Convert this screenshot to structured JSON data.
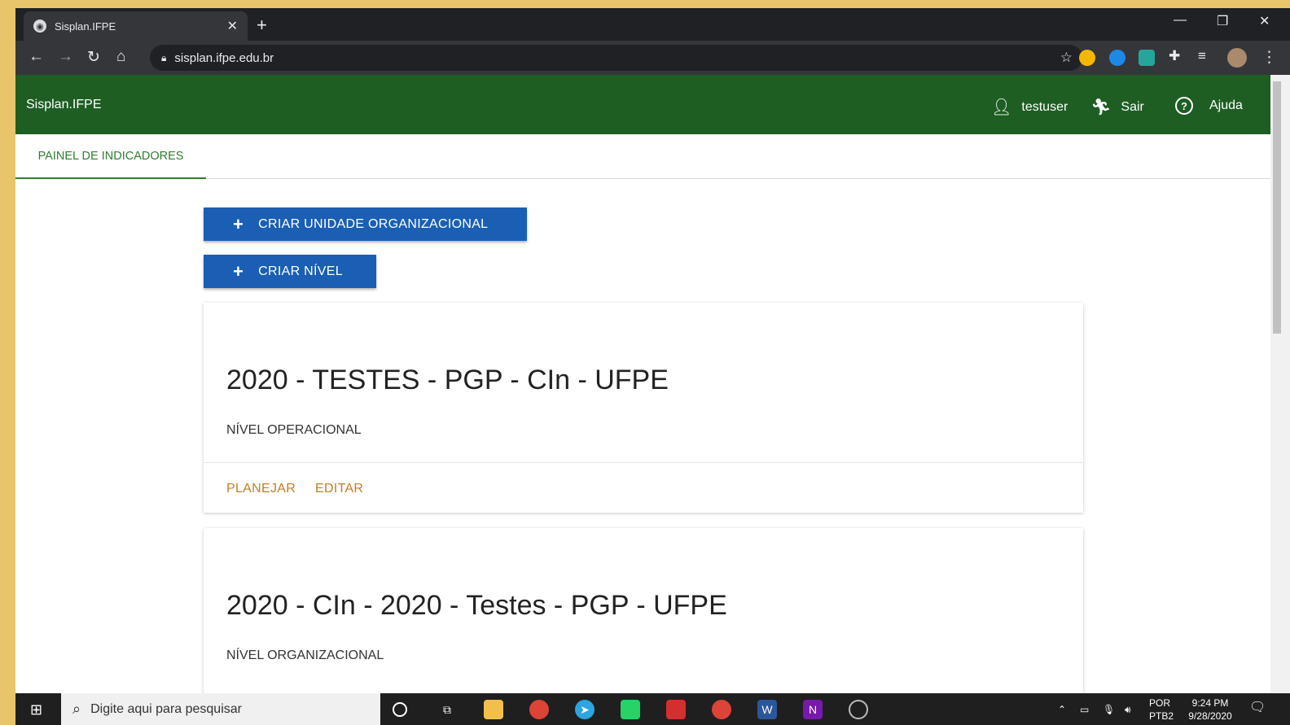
{
  "browser": {
    "tab_title": "Sisplan.IFPE",
    "url": "sisplan.ifpe.edu.br"
  },
  "app": {
    "brand": "Sisplan.IFPE",
    "user": "testuser",
    "logout": "Sair",
    "help": "Ajuda",
    "nav_tab": "PAINEL DE INDICADORES"
  },
  "actions": {
    "create_unit": "CRIAR UNIDADE ORGANIZACIONAL",
    "create_level": "CRIAR NÍVEL"
  },
  "cards": [
    {
      "title": "2020 - TESTES - PGP - CIn - UFPE",
      "level": "NÍVEL OPERACIONAL",
      "plan_label": "PLANEJAR",
      "edit_label": "EDITAR"
    },
    {
      "title": "2020 - CIn - 2020 - Testes - PGP - UFPE",
      "level": "NÍVEL ORGANIZACIONAL"
    }
  ],
  "taskbar": {
    "search_placeholder": "Digite aqui para pesquisar",
    "lang": "POR",
    "layout": "PTB2",
    "time": "9:24 PM",
    "date": "9/28/2020"
  },
  "colors": {
    "app_bar": "#1e5e23",
    "primary_button": "#1a5fb4",
    "card_action": "#c77c24",
    "active_tab": "#2e7d32"
  }
}
